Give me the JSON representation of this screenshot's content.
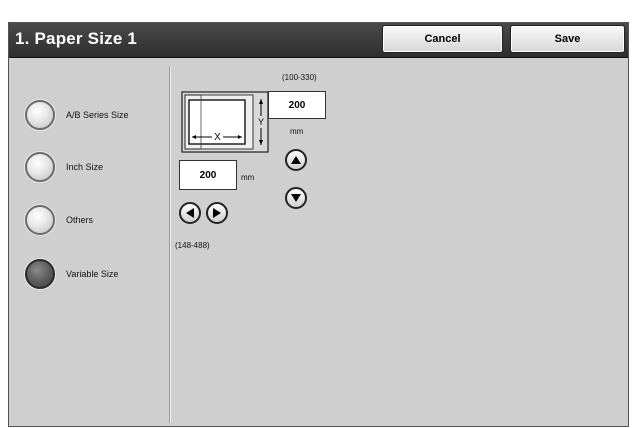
{
  "header": {
    "title": "1. Paper Size 1",
    "cancel_label": "Cancel",
    "save_label": "Save"
  },
  "options": [
    {
      "label": "A/B Series Size",
      "selected": false
    },
    {
      "label": "Inch Size",
      "selected": false
    },
    {
      "label": "Others",
      "selected": false
    },
    {
      "label": "Variable Size",
      "selected": true
    }
  ],
  "y_size": {
    "range": "(100-330)",
    "value": "200",
    "unit": "mm"
  },
  "x_size": {
    "range": "(148-488)",
    "value": "200",
    "unit": "mm"
  },
  "icons": [
    "up-arrow-icon",
    "down-arrow-icon",
    "left-arrow-icon",
    "right-arrow-icon",
    "paper-size-diagram-icon"
  ]
}
